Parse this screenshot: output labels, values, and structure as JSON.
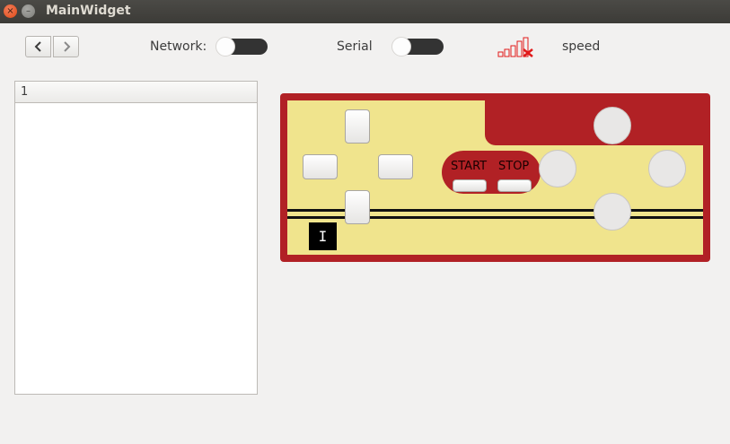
{
  "window": {
    "title": "MainWidget",
    "close_glyph": "×",
    "minimize_glyph": "–"
  },
  "toolbar": {
    "back_icon": "chevron-left-icon",
    "forward_icon": "chevron-right-icon",
    "network_label": "Network:",
    "network_on": false,
    "serial_label": "Serial",
    "serial_on": false,
    "signal_icon": "signal-no-connection-icon",
    "speed_label": "speed"
  },
  "list": {
    "header": "1",
    "items": []
  },
  "gamepad": {
    "start_label": "START",
    "stop_label": "STOP",
    "cursor_glyph": "I",
    "colors": {
      "body": "#b12125",
      "face": "#f0e48d",
      "stripe": "#111111",
      "round_button": "#e8e7e6"
    }
  },
  "colors": {
    "titlebar": "#3c3b37",
    "close": "#df4a16",
    "background": "#f2f1f0",
    "toggle_track": "#333333",
    "signal_red": "#e11a1a"
  }
}
